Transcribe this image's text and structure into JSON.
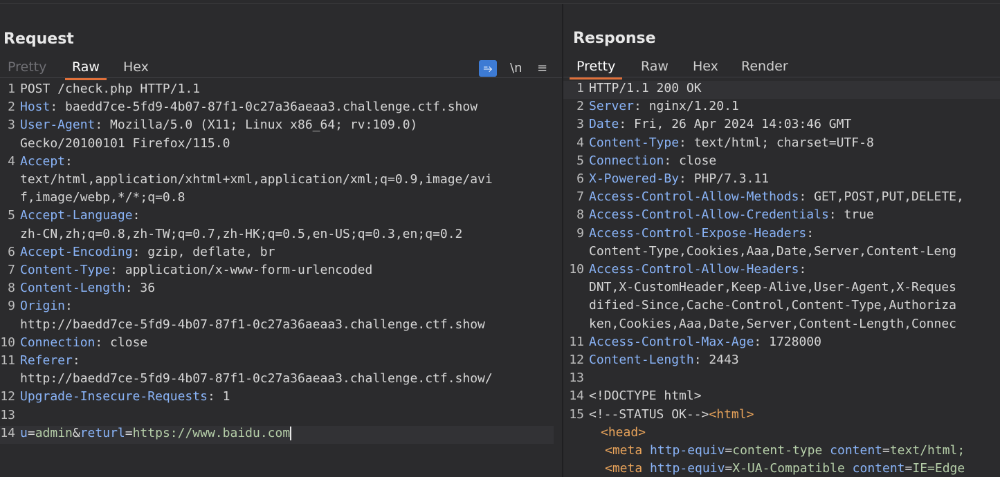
{
  "request": {
    "title": "Request",
    "tabs": [
      "Pretty",
      "Raw",
      "Hex"
    ],
    "active_tab": "Raw",
    "tools": {
      "wrap": "⥱",
      "newline": "\\n",
      "menu": "≡"
    },
    "lines": [
      {
        "n": "1",
        "key": "",
        "val": "POST /check.php HTTP/1.1"
      },
      {
        "n": "2",
        "key": "Host",
        "val": " baedd7ce-5fd9-4b07-87f1-0c27a36aeaa3.challenge.ctf.show"
      },
      {
        "n": "3",
        "key": "User-Agent",
        "val": " Mozilla/5.0 (X11; Linux x86_64; rv:109.0)"
      },
      {
        "n": "",
        "key": "",
        "val": "Gecko/20100101 Firefox/115.0"
      },
      {
        "n": "4",
        "key": "Accept",
        "val": ""
      },
      {
        "n": "",
        "key": "",
        "val": "text/html,application/xhtml+xml,application/xml;q=0.9,image/avi"
      },
      {
        "n": "",
        "key": "",
        "val": "f,image/webp,*/*;q=0.8"
      },
      {
        "n": "5",
        "key": "Accept-Language",
        "val": ""
      },
      {
        "n": "",
        "key": "",
        "val": "zh-CN,zh;q=0.8,zh-TW;q=0.7,zh-HK;q=0.5,en-US;q=0.3,en;q=0.2"
      },
      {
        "n": "6",
        "key": "Accept-Encoding",
        "val": " gzip, deflate, br"
      },
      {
        "n": "7",
        "key": "Content-Type",
        "val": " application/x-www-form-urlencoded"
      },
      {
        "n": "8",
        "key": "Content-Length",
        "val": " 36"
      },
      {
        "n": "9",
        "key": "Origin",
        "val": ""
      },
      {
        "n": "",
        "key": "",
        "val": "http://baedd7ce-5fd9-4b07-87f1-0c27a36aeaa3.challenge.ctf.show"
      },
      {
        "n": "10",
        "key": "Connection",
        "val": " close"
      },
      {
        "n": "11",
        "key": "Referer",
        "val": ""
      },
      {
        "n": "",
        "key": "",
        "val": "http://baedd7ce-5fd9-4b07-87f1-0c27a36aeaa3.challenge.ctf.show/"
      },
      {
        "n": "12",
        "key": "Upgrade-Insecure-Requests",
        "val": " 1"
      },
      {
        "n": "13",
        "key": "",
        "val": ""
      }
    ],
    "body_line": {
      "n": "14",
      "p1k": "u",
      "p1eq": "=",
      "p1v": "admin",
      "amp": "&",
      "p2k": "returl",
      "p2eq": "=",
      "p2v": "https://www.baidu.com"
    }
  },
  "response": {
    "title": "Response",
    "tabs": [
      "Pretty",
      "Raw",
      "Hex",
      "Render"
    ],
    "active_tab": "Pretty",
    "lines": [
      {
        "n": "1",
        "key": "",
        "val": "HTTP/1.1 200 OK"
      },
      {
        "n": "2",
        "key": "Server",
        "val": " nginx/1.20.1"
      },
      {
        "n": "3",
        "key": "Date",
        "val": " Fri, 26 Apr 2024 14:03:46 GMT"
      },
      {
        "n": "4",
        "key": "Content-Type",
        "val": " text/html; charset=UTF-8"
      },
      {
        "n": "5",
        "key": "Connection",
        "val": " close"
      },
      {
        "n": "6",
        "key": "X-Powered-By",
        "val": " PHP/7.3.11"
      },
      {
        "n": "7",
        "key": "Access-Control-Allow-Methods",
        "val": " GET,POST,PUT,DELETE,"
      },
      {
        "n": "8",
        "key": "Access-Control-Allow-Credentials",
        "val": " true"
      },
      {
        "n": "9",
        "key": "Access-Control-Expose-Headers",
        "val": ""
      },
      {
        "n": "",
        "key": "",
        "val": "Content-Type,Cookies,Aaa,Date,Server,Content-Leng"
      },
      {
        "n": "10",
        "key": "Access-Control-Allow-Headers",
        "val": ""
      },
      {
        "n": "",
        "key": "",
        "val": "DNT,X-CustomHeader,Keep-Alive,User-Agent,X-Reques"
      },
      {
        "n": "",
        "key": "",
        "val": "dified-Since,Cache-Control,Content-Type,Authoriza"
      },
      {
        "n": "",
        "key": "",
        "val": "ken,Cookies,Aaa,Date,Server,Content-Length,Connec"
      },
      {
        "n": "11",
        "key": "Access-Control-Max-Age",
        "val": " 1728000"
      },
      {
        "n": "12",
        "key": "Content-Length",
        "val": " 2443"
      },
      {
        "n": "13",
        "key": "",
        "val": ""
      }
    ],
    "html_lines": {
      "l14": "<!DOCTYPE html>",
      "l15_comment": "<!--STATUS OK-->",
      "l15_tag": "<html>",
      "head_tag": "<head>",
      "meta1": {
        "tag": "<meta",
        "attr1": "http-equiv",
        "eq1": "=",
        "val1": "content-type",
        "attr2": "content",
        "eq2": "=",
        "val2": "text/html;"
      },
      "meta2": {
        "tag": "<meta",
        "attr1": "http-equiv",
        "eq1": "=",
        "val1": "X-UA-Compatible",
        "attr2": "content",
        "eq2": "=",
        "val2": "IE=Edge"
      }
    }
  }
}
